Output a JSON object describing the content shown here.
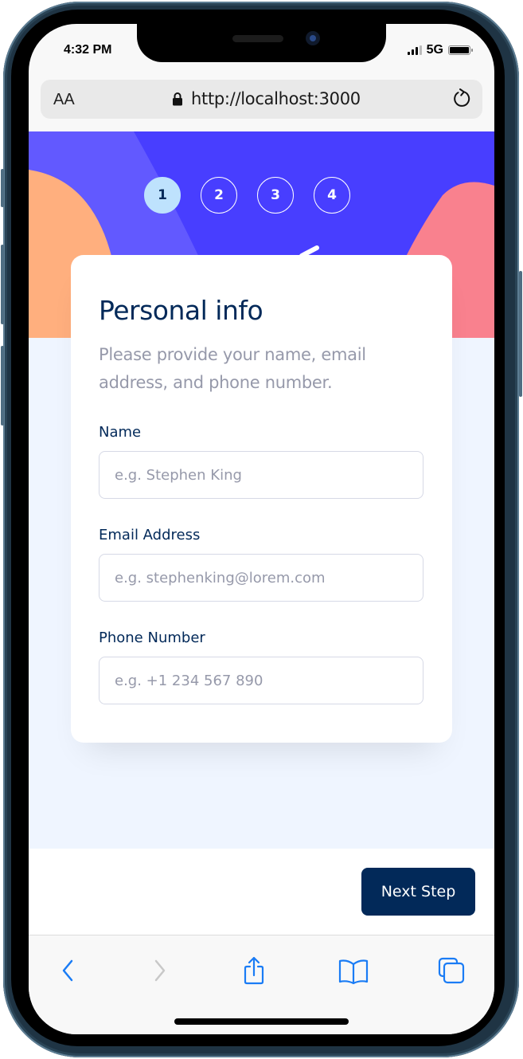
{
  "device": {
    "status_bar": {
      "time": "4:32 PM",
      "network": "5G"
    }
  },
  "browser": {
    "text_size_label": "AA",
    "url": "http://localhost:3000",
    "icons": {
      "lock": "lock-icon",
      "reload": "reload-icon"
    }
  },
  "theme": {
    "hero_bg": "#483eff",
    "accent_orange": "#ffaf7e",
    "accent_pink": "#f9818e",
    "step_active_bg": "#bee2fd",
    "primary_text": "#022959",
    "muted_text": "#9699aa",
    "page_bg": "#eff5ff"
  },
  "stepper": {
    "steps": [
      {
        "number": "1",
        "active": true
      },
      {
        "number": "2",
        "active": false
      },
      {
        "number": "3",
        "active": false
      },
      {
        "number": "4",
        "active": false
      }
    ]
  },
  "form": {
    "title": "Personal info",
    "description": "Please provide your name, email address, and phone number.",
    "fields": [
      {
        "label": "Name",
        "value": "",
        "placeholder": "e.g. Stephen King"
      },
      {
        "label": "Email Address",
        "value": "",
        "placeholder": "e.g. stephenking@lorem.com"
      },
      {
        "label": "Phone Number",
        "value": "",
        "placeholder": "e.g. +1 234 567 890"
      }
    ]
  },
  "footer": {
    "next_label": "Next Step"
  },
  "toolbar": {
    "items": [
      {
        "icon": "back-icon",
        "enabled": true
      },
      {
        "icon": "forward-icon",
        "enabled": false
      },
      {
        "icon": "share-icon",
        "enabled": true
      },
      {
        "icon": "bookmarks-icon",
        "enabled": true
      },
      {
        "icon": "tabs-icon",
        "enabled": true
      }
    ]
  }
}
